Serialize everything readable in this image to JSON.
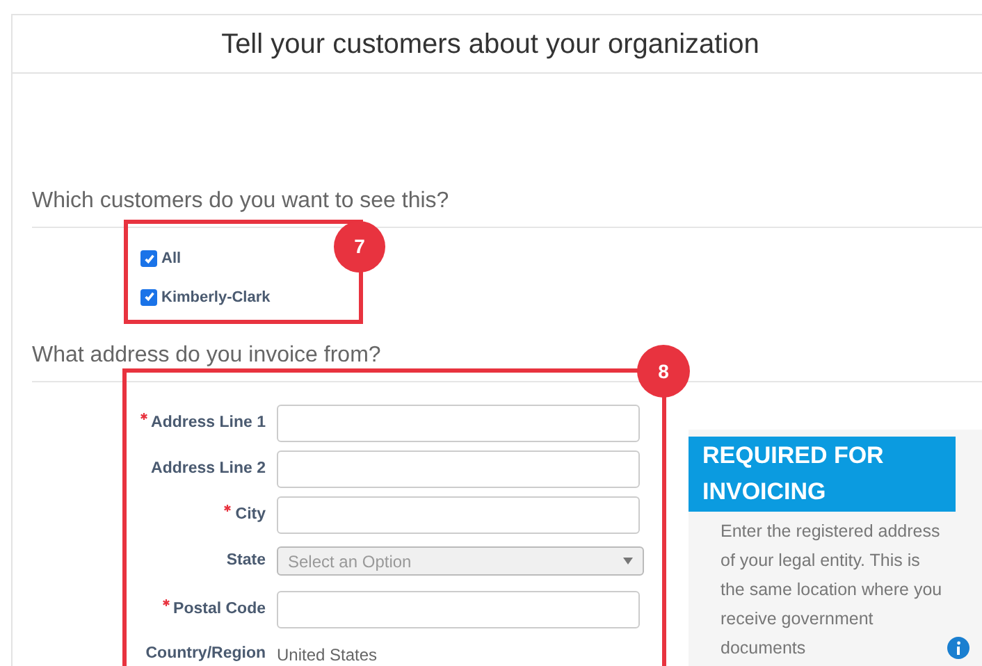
{
  "header": {
    "title": "Tell your customers about your organization"
  },
  "customers": {
    "question": "Which customers do you want to see this?",
    "options": [
      {
        "label": "All",
        "checked": true
      },
      {
        "label": "Kimberly-Clark",
        "checked": true
      }
    ],
    "callout": "7"
  },
  "address": {
    "question": "What address do you invoice from?",
    "fields": [
      {
        "kind": "text",
        "label": "Address Line 1",
        "required": true
      },
      {
        "kind": "text",
        "label": "Address Line 2",
        "required": false
      },
      {
        "kind": "text",
        "label": "City",
        "required": true
      },
      {
        "kind": "select",
        "label": "State",
        "required": false,
        "placeholder": "Select an Option"
      },
      {
        "kind": "text",
        "label": "Postal Code",
        "required": true
      },
      {
        "kind": "static",
        "label": "Country/Region",
        "required": false,
        "value": "United States"
      }
    ],
    "callout": "8"
  },
  "info_panel": {
    "title": "REQUIRED FOR INVOICING",
    "text": "Enter the registered address of your legal entity. This is the same location where you receive government documents"
  }
}
